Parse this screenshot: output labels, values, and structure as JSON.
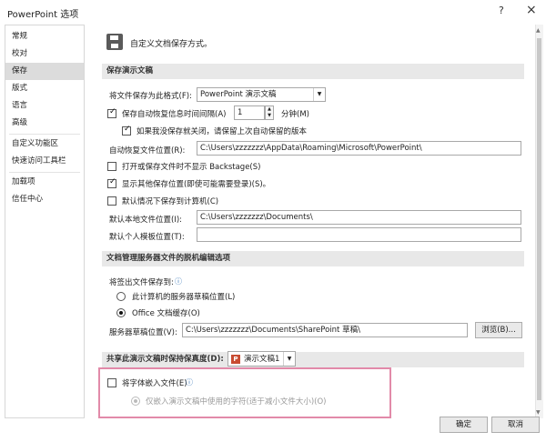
{
  "window": {
    "title": "PowerPoint 选项",
    "help_label": "?",
    "close_label": "×"
  },
  "nav": {
    "items": [
      {
        "label": "常规"
      },
      {
        "label": "校对"
      },
      {
        "label": "保存"
      },
      {
        "label": "版式"
      },
      {
        "label": "语言"
      },
      {
        "label": "高级"
      },
      {
        "label": "自定义功能区"
      },
      {
        "label": "快速访问工具栏"
      },
      {
        "label": "加载项"
      },
      {
        "label": "信任中心"
      }
    ],
    "active_index": 2
  },
  "header": {
    "text": "自定义文档保存方式。"
  },
  "sections": {
    "save": "保存演示文稿",
    "offline": "文档管理服务器文件的脱机编辑选项",
    "fidelity": "共享此演示文稿时保持保真度(D):"
  },
  "save_format": {
    "label": "将文件保存为此格式(F):",
    "value": "PowerPoint 演示文稿"
  },
  "autorecover": {
    "label": "保存自动恢复信息时间间隔(A)",
    "minutes": "1",
    "unit": "分钟(M)",
    "keep_last": "如果我没保存就关闭，请保留上次自动保留的版本",
    "location_label": "自动恢复文件位置(R):",
    "location_value": "C:\\Users\\zzzzzzz\\AppData\\Roaming\\Microsoft\\PowerPoint\\"
  },
  "options": {
    "backstage": "打开或保存文件时不显示 Backstage(S)",
    "other_locations": "显示其他保存位置(即使可能需要登录)(S)。",
    "default_computer": "默认情况下保存到计算机(C)"
  },
  "local": {
    "label": "默认本地文件位置(I):",
    "value": "C:\\Users\\zzzzzzz\\Documents\\",
    "template_label": "默认个人模板位置(T):",
    "template_value": ""
  },
  "checkout": {
    "label": "将签出文件保存到:",
    "server_option": "此计算机的服务器草稿位置(L)",
    "office_option": "Office 文档缓存(O)"
  },
  "drafts": {
    "label": "服务器草稿位置(V):",
    "value": "C:\\Users\\zzzzzzz\\Documents\\SharePoint 草稿\\",
    "browse_label": "浏览(B)..."
  },
  "fidelity": {
    "doc_name": "演示文稿1",
    "embed_fonts": "将字体嵌入文件(E)",
    "embed_used_only": "仅嵌入演示文稿中使用的字符(适于减小文件大小)(O)"
  },
  "footer": {
    "ok": "确定",
    "cancel": "取消"
  },
  "state": {
    "autorecover_checked": true,
    "keep_last_checked": true,
    "backstage_checked": false,
    "other_locations_checked": true,
    "default_computer_checked": false,
    "checkout_office_selected": true,
    "embed_fonts_checked": false
  },
  "colors": {
    "highlight_border": "#e28aa9",
    "section_bg": "#e8e8e8",
    "ppt_icon": "#c84b31"
  }
}
